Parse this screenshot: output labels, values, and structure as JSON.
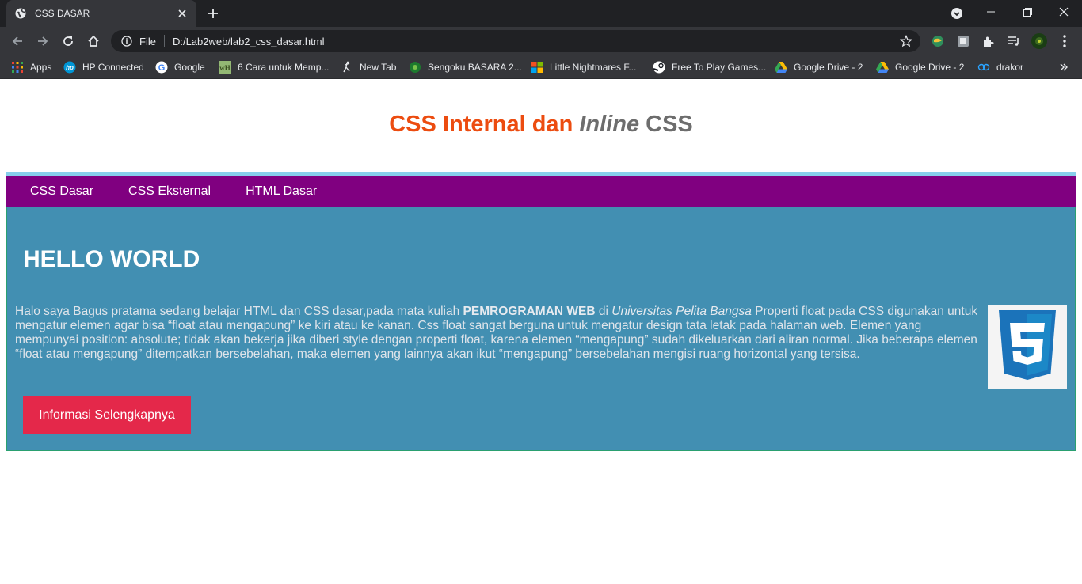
{
  "browser": {
    "tab": {
      "title": "CSS DASAR"
    },
    "address": {
      "scheme_label": "File",
      "url": "D:/Lab2web/lab2_css_dasar.html"
    },
    "bookmarks": [
      {
        "label": "Apps",
        "icon": "apps-grid-icon"
      },
      {
        "label": "HP Connected",
        "icon": "hp-icon"
      },
      {
        "label": "Google",
        "icon": "google-icon"
      },
      {
        "label": "6 Cara untuk Memp...",
        "icon": "wikihow-icon"
      },
      {
        "label": "New Tab",
        "icon": "newtab-figure-icon"
      },
      {
        "label": "Sengoku BASARA 2...",
        "icon": "game-icon"
      },
      {
        "label": "Little Nightmares F...",
        "icon": "windows-icon"
      },
      {
        "label": "Free To Play Games...",
        "icon": "steam-icon"
      },
      {
        "label": "Google Drive - 2",
        "icon": "google-drive-icon"
      },
      {
        "label": "Google Drive - 2",
        "icon": "google-drive-icon"
      },
      {
        "label": "drakor",
        "icon": "drakor-icon"
      }
    ]
  },
  "page": {
    "title_part1": "CSS Internal dan ",
    "title_part2": "Inline",
    "title_part3": " CSS",
    "nav": [
      "CSS Dasar",
      "CSS Eksternal",
      "HTML Dasar"
    ],
    "hero": {
      "heading": "HELLO WORLD",
      "text_1": "Halo saya Bagus pratama sedang belajar HTML dan CSS dasar,pada mata kuliah ",
      "text_bold": "PEMROGRAMAN WEB",
      "text_2": " di ",
      "text_italic": "Universitas Pelita Bangsa",
      "text_3": " Properti float pada CSS digunakan untuk mengatur elemen agar bisa “float atau mengapung” ke kiri atau ke kanan. Css float sangat berguna untuk mengatur design tata letak pada halaman web. Elemen yang mempunyai position: absolute; tidak akan bekerja jika diberi style dengan properti float, karena elemen “mengapung” sudah dikeluarkan dari aliran normal. Jika beberapa elemen “float atau mengapung” ditempatkan bersebelahan, maka elemen yang lainnya akan ikut “mengapung” bersebelahan mengisi ruang horizontal yang tersisa.",
      "button_label": "Informasi Selengkapnya",
      "image_icon": "css3-logo-icon"
    }
  },
  "colors": {
    "nav_bg": "#800080",
    "nav_border": "#87ceeb",
    "hero_bg": "#428fb2",
    "cta_bg": "#e4284a",
    "title_accent": "#ec4c10",
    "title_muted": "#6d6d6d"
  }
}
